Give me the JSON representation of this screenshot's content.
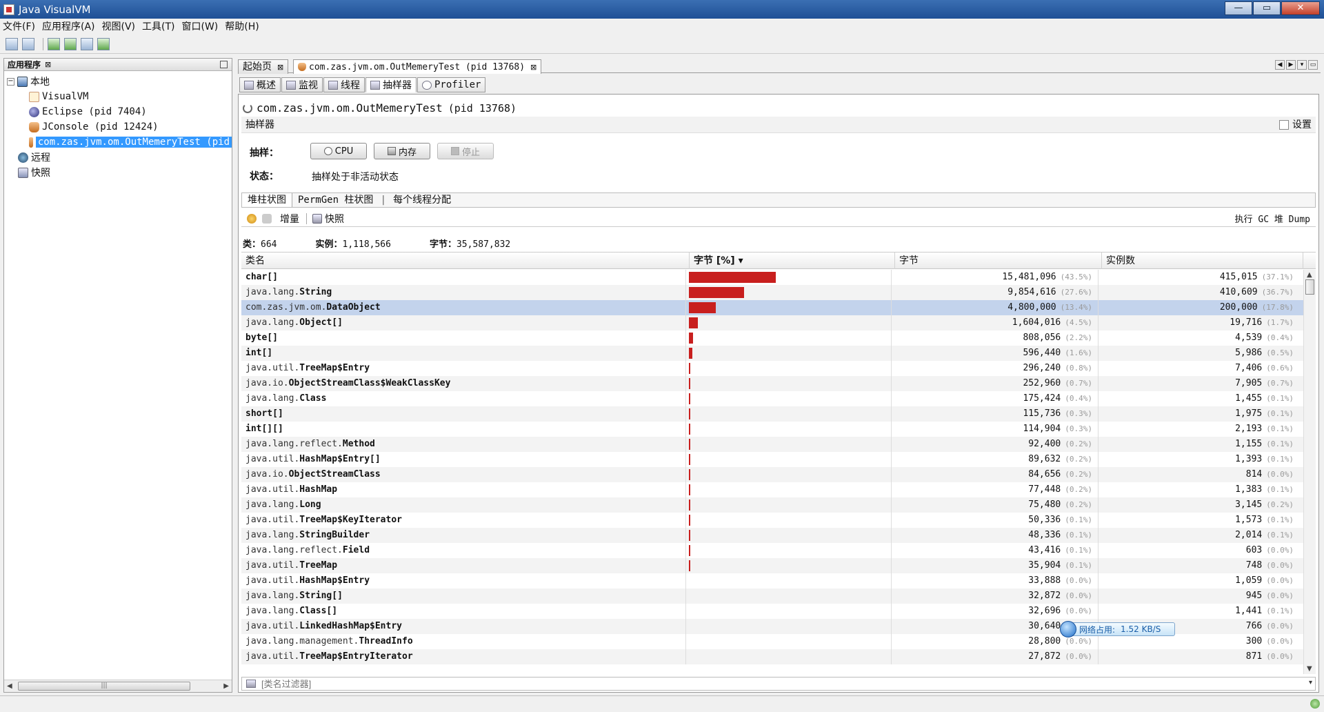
{
  "window": {
    "title": "Java VisualVM",
    "btn_min": "—",
    "btn_max": "▭",
    "btn_close": "✕"
  },
  "menu": [
    "文件(F)",
    "应用程序(A)",
    "视图(V)",
    "工具(T)",
    "窗口(W)",
    "帮助(H)"
  ],
  "left_panel": {
    "title": "应用程序",
    "close": "⊠",
    "tree": {
      "local": "本地",
      "visualvm": "VisualVM",
      "eclipse": "Eclipse (pid 7404)",
      "jconsole": "JConsole (pid 12424)",
      "outmem": "com.zas.jvm.om.OutMemeryTest (pid",
      "remote": "远程",
      "snapshots": "快照"
    },
    "hscroll_grip": "|||"
  },
  "doc_tabs": [
    {
      "label": "起始页",
      "close": "⊠"
    },
    {
      "label": "com.zas.jvm.om.OutMemeryTest (pid 13768)",
      "close": "⊠"
    }
  ],
  "sub_tabs": [
    "概述",
    "监视",
    "线程",
    "抽样器",
    "Profiler"
  ],
  "main": {
    "process_title": "com.zas.jvm.om.OutMemeryTest",
    "process_pid": "(pid 13768)",
    "sampler_header": "抽样器",
    "settings_label": "设置",
    "sample_label": "抽样：",
    "cpu_button": "CPU",
    "memory_button": "内存",
    "stop_button": "停止",
    "status_label": "状态：",
    "status_value": "抽样处于非活动状态"
  },
  "view_tabs": [
    "堆柱状图",
    "PermGen 柱状图",
    "|",
    "每个线程分配"
  ],
  "actions": {
    "delta": "增量",
    "snapshot": "快照",
    "right": "执行 GC  堆 Dump"
  },
  "summary": {
    "classes_label": "类：",
    "classes_value": "664",
    "instances_label": "实例：",
    "instances_value": "1,118,566",
    "bytes_label": "字节：",
    "bytes_value": "35,587,832"
  },
  "table": {
    "columns": [
      "类名",
      "字节 [%] ▾",
      "字节",
      "实例数"
    ],
    "rows": [
      {
        "pkg": "",
        "cls": "char[]",
        "pct": 43.5,
        "bytes": "15,481,096",
        "bytes_pct": "(43.5%)",
        "inst": "415,015",
        "inst_pct": "(37.1%)"
      },
      {
        "pkg": "java.lang.",
        "cls": "String",
        "pct": 27.6,
        "bytes": "9,854,616",
        "bytes_pct": "(27.6%)",
        "inst": "410,609",
        "inst_pct": "(36.7%)"
      },
      {
        "pkg": "com.zas.jvm.om.",
        "cls": "DataObject",
        "pct": 13.4,
        "bytes": "4,800,000",
        "bytes_pct": "(13.4%)",
        "inst": "200,000",
        "inst_pct": "(17.8%)",
        "selected": true
      },
      {
        "pkg": "java.lang.",
        "cls": "Object[]",
        "pct": 4.5,
        "bytes": "1,604,016",
        "bytes_pct": "(4.5%)",
        "inst": "19,716",
        "inst_pct": "(1.7%)"
      },
      {
        "pkg": "",
        "cls": "byte[]",
        "pct": 2.2,
        "bytes": "808,056",
        "bytes_pct": "(2.2%)",
        "inst": "4,539",
        "inst_pct": "(0.4%)"
      },
      {
        "pkg": "",
        "cls": "int[]",
        "pct": 1.6,
        "bytes": "596,440",
        "bytes_pct": "(1.6%)",
        "inst": "5,986",
        "inst_pct": "(0.5%)"
      },
      {
        "pkg": "java.util.",
        "cls": "TreeMap$Entry",
        "pct": 0.8,
        "bytes": "296,240",
        "bytes_pct": "(0.8%)",
        "inst": "7,406",
        "inst_pct": "(0.6%)"
      },
      {
        "pkg": "java.io.",
        "cls": "ObjectStreamClass$WeakClassKey",
        "pct": 0.7,
        "bytes": "252,960",
        "bytes_pct": "(0.7%)",
        "inst": "7,905",
        "inst_pct": "(0.7%)"
      },
      {
        "pkg": "java.lang.",
        "cls": "Class",
        "pct": 0.4,
        "bytes": "175,424",
        "bytes_pct": "(0.4%)",
        "inst": "1,455",
        "inst_pct": "(0.1%)"
      },
      {
        "pkg": "",
        "cls": "short[]",
        "pct": 0.3,
        "bytes": "115,736",
        "bytes_pct": "(0.3%)",
        "inst": "1,975",
        "inst_pct": "(0.1%)"
      },
      {
        "pkg": "",
        "cls": "int[][]",
        "pct": 0.3,
        "bytes": "114,904",
        "bytes_pct": "(0.3%)",
        "inst": "2,193",
        "inst_pct": "(0.1%)"
      },
      {
        "pkg": "java.lang.reflect.",
        "cls": "Method",
        "pct": 0.2,
        "bytes": "92,400",
        "bytes_pct": "(0.2%)",
        "inst": "1,155",
        "inst_pct": "(0.1%)"
      },
      {
        "pkg": "java.util.",
        "cls": "HashMap$Entry[]",
        "pct": 0.2,
        "bytes": "89,632",
        "bytes_pct": "(0.2%)",
        "inst": "1,393",
        "inst_pct": "(0.1%)"
      },
      {
        "pkg": "java.io.",
        "cls": "ObjectStreamClass",
        "pct": 0.2,
        "bytes": "84,656",
        "bytes_pct": "(0.2%)",
        "inst": "814",
        "inst_pct": "(0.0%)"
      },
      {
        "pkg": "java.util.",
        "cls": "HashMap",
        "pct": 0.2,
        "bytes": "77,448",
        "bytes_pct": "(0.2%)",
        "inst": "1,383",
        "inst_pct": "(0.1%)"
      },
      {
        "pkg": "java.lang.",
        "cls": "Long",
        "pct": 0.2,
        "bytes": "75,480",
        "bytes_pct": "(0.2%)",
        "inst": "3,145",
        "inst_pct": "(0.2%)"
      },
      {
        "pkg": "java.util.",
        "cls": "TreeMap$KeyIterator",
        "pct": 0.1,
        "bytes": "50,336",
        "bytes_pct": "(0.1%)",
        "inst": "1,573",
        "inst_pct": "(0.1%)"
      },
      {
        "pkg": "java.lang.",
        "cls": "StringBuilder",
        "pct": 0.1,
        "bytes": "48,336",
        "bytes_pct": "(0.1%)",
        "inst": "2,014",
        "inst_pct": "(0.1%)"
      },
      {
        "pkg": "java.lang.reflect.",
        "cls": "Field",
        "pct": 0.1,
        "bytes": "43,416",
        "bytes_pct": "(0.1%)",
        "inst": "603",
        "inst_pct": "(0.0%)"
      },
      {
        "pkg": "java.util.",
        "cls": "TreeMap",
        "pct": 0.1,
        "bytes": "35,904",
        "bytes_pct": "(0.1%)",
        "inst": "748",
        "inst_pct": "(0.0%)"
      },
      {
        "pkg": "java.util.",
        "cls": "HashMap$Entry",
        "pct": 0.0,
        "bytes": "33,888",
        "bytes_pct": "(0.0%)",
        "inst": "1,059",
        "inst_pct": "(0.0%)"
      },
      {
        "pkg": "java.lang.",
        "cls": "String[]",
        "pct": 0.0,
        "bytes": "32,872",
        "bytes_pct": "(0.0%)",
        "inst": "945",
        "inst_pct": "(0.0%)"
      },
      {
        "pkg": "java.lang.",
        "cls": "Class[]",
        "pct": 0.0,
        "bytes": "32,696",
        "bytes_pct": "(0.0%)",
        "inst": "1,441",
        "inst_pct": "(0.1%)"
      },
      {
        "pkg": "java.util.",
        "cls": "LinkedHashMap$Entry",
        "pct": 0.0,
        "bytes": "30,640",
        "bytes_pct": "(0.0%)",
        "inst": "766",
        "inst_pct": "(0.0%)"
      },
      {
        "pkg": "java.lang.management.",
        "cls": "ThreadInfo",
        "pct": 0.0,
        "bytes": "28,800",
        "bytes_pct": "(0.0%)",
        "inst": "300",
        "inst_pct": "(0.0%)"
      },
      {
        "pkg": "java.util.",
        "cls": "TreeMap$EntryIterator",
        "pct": 0.0,
        "bytes": "27,872",
        "bytes_pct": "(0.0%)",
        "inst": "871",
        "inst_pct": "(0.0%)"
      }
    ]
  },
  "filter": {
    "placeholder": "[类名过滤器]",
    "dropdown": "▾"
  },
  "network_tip": {
    "label": "网络占用:",
    "value": "1.52 KB/S"
  },
  "colors": {
    "bar": "#c81f1e",
    "selection": "#c3d3ec",
    "title_bar": "#1e4f95"
  }
}
